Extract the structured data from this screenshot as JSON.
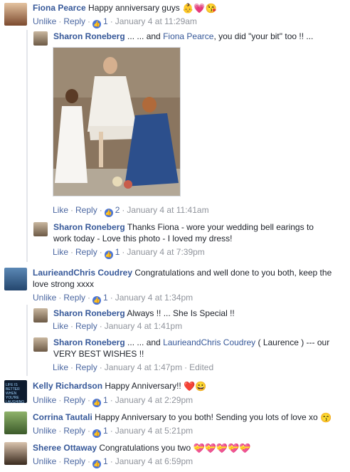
{
  "comments": [
    {
      "name": "Fiona Pearce",
      "text": "Happy anniversary guys",
      "emoji": "👶💗😘",
      "actions": {
        "like": "Unlike",
        "reply": "Reply",
        "count": "1",
        "time": "January 4 at 11:29am"
      }
    },
    {
      "name": "Sharon Roneberg",
      "pre": "... ... and",
      "mention": "Fiona Pearce",
      "post": ", you did \"your bit\" too !! ...",
      "actions": {
        "like": "Like",
        "reply": "Reply",
        "count": "2",
        "time": "January 4 at 11:41am"
      }
    },
    {
      "name": "Sharon Roneberg",
      "text": "Thanks Fiona - wore your wedding bell earings to work today - Love this photo - I loved my dress!",
      "actions": {
        "like": "Like",
        "reply": "Reply",
        "count": "1",
        "time": "January 4 at 7:39pm"
      }
    },
    {
      "name": "LaurieandChris Coudrey",
      "text": "Congratulations and well done to you both, keep the love strong xxxx",
      "actions": {
        "like": "Unlike",
        "reply": "Reply",
        "count": "1",
        "time": "January 4 at 1:34pm"
      }
    },
    {
      "name": "Sharon Roneberg",
      "text": "Always !! ... She Is Special !!",
      "actions": {
        "like": "Like",
        "reply": "Reply",
        "time": "January 4 at 1:41pm"
      }
    },
    {
      "name": "Sharon Roneberg",
      "pre": "... ... and",
      "mention": "LaurieandChris Coudrey",
      "post": "( Laurence ) --- our VERY BEST WISHES !!",
      "actions": {
        "like": "Like",
        "reply": "Reply",
        "time": "January 4 at 1:47pm",
        "edited": "Edited"
      }
    },
    {
      "name": "Kelly Richardson",
      "text": "Happy Anniversary!!",
      "emoji": "❤️😀",
      "avatar_text": "LIFE IS BETTER WHEN YOU'RE LAUGHING",
      "actions": {
        "like": "Unlike",
        "reply": "Reply",
        "count": "1",
        "time": "January 4 at 2:29pm"
      }
    },
    {
      "name": "Corrina Tautali",
      "text": "Happy Anniversary to you both! Sending you lots of love xo",
      "emoji": "😙",
      "actions": {
        "like": "Unlike",
        "reply": "Reply",
        "count": "1",
        "time": "January 4 at 5:21pm"
      }
    },
    {
      "name": "Sheree Ottaway",
      "text": "Congratulations you two",
      "emoji": "💝💝💝💝💝",
      "actions": {
        "like": "Unlike",
        "reply": "Reply",
        "count": "1",
        "time": "January 4 at 6:59pm"
      }
    }
  ],
  "icons": {
    "like": "thumbs-up-icon"
  }
}
